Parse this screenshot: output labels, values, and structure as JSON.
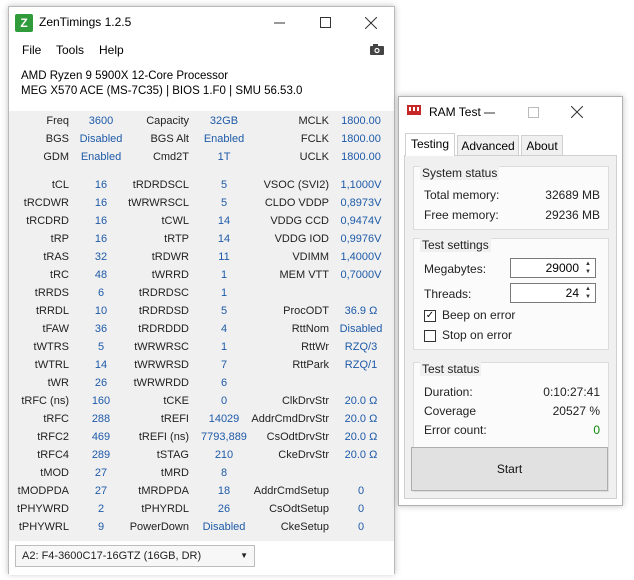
{
  "zentimings": {
    "title": "ZenTimings 1.2.5",
    "icon_letter": "Z",
    "menu": [
      "File",
      "Tools",
      "Help"
    ],
    "cpu_name": "AMD Ryzen 9 5900X 12-Core Processor",
    "board_info": "MEG X570 ACE (MS-7C35) | BIOS 1.F0 | SMU 56.53.0",
    "top_rows": [
      {
        "l1": "Freq",
        "v1": "3600",
        "l2": "Capacity",
        "v2": "32GB",
        "l3": "MCLK",
        "v3": "1800.00"
      },
      {
        "l1": "BGS",
        "v1": "Disabled",
        "l2": "BGS Alt",
        "v2": "Enabled",
        "l3": "FCLK",
        "v3": "1800.00"
      },
      {
        "l1": "GDM",
        "v1": "Enabled",
        "l2": "Cmd2T",
        "v2": "1T",
        "l3": "UCLK",
        "v3": "1800.00"
      }
    ],
    "rows": [
      {
        "l1": "tCL",
        "v1": "16",
        "l2": "tRDRDSCL",
        "v2": "5",
        "l3": "VSOC (SVI2)",
        "v3": "1,1000V"
      },
      {
        "l1": "tRCDWR",
        "v1": "16",
        "l2": "tWRWRSCL",
        "v2": "5",
        "l3": "CLDO VDDP",
        "v3": "0,8973V"
      },
      {
        "l1": "tRCDRD",
        "v1": "16",
        "l2": "tCWL",
        "v2": "14",
        "l3": "VDDG CCD",
        "v3": "0,9474V"
      },
      {
        "l1": "tRP",
        "v1": "16",
        "l2": "tRTP",
        "v2": "14",
        "l3": "VDDG IOD",
        "v3": "0,9976V"
      },
      {
        "l1": "tRAS",
        "v1": "32",
        "l2": "tRDWR",
        "v2": "11",
        "l3": "VDIMM",
        "v3": "1,4000V"
      },
      {
        "l1": "tRC",
        "v1": "48",
        "l2": "tWRRD",
        "v2": "1",
        "l3": "MEM VTT",
        "v3": "0,7000V"
      },
      {
        "l1": "tRRDS",
        "v1": "6",
        "l2": "tRDRDSC",
        "v2": "1",
        "l3": "",
        "v3": ""
      },
      {
        "l1": "tRRDL",
        "v1": "10",
        "l2": "tRDRDSD",
        "v2": "5",
        "l3": "ProcODT",
        "v3": "36.9 Ω"
      },
      {
        "l1": "tFAW",
        "v1": "36",
        "l2": "tRDRDDD",
        "v2": "4",
        "l3": "RttNom",
        "v3": "Disabled"
      },
      {
        "l1": "tWTRS",
        "v1": "5",
        "l2": "tWRWRSC",
        "v2": "1",
        "l3": "RttWr",
        "v3": "RZQ/3"
      },
      {
        "l1": "tWTRL",
        "v1": "14",
        "l2": "tWRWRSD",
        "v2": "7",
        "l3": "RttPark",
        "v3": "RZQ/1"
      },
      {
        "l1": "tWR",
        "v1": "26",
        "l2": "tWRWRDD",
        "v2": "6",
        "l3": "",
        "v3": ""
      },
      {
        "l1": "tRFC (ns)",
        "v1": "160",
        "l2": "tCKE",
        "v2": "0",
        "l3": "ClkDrvStr",
        "v3": "20.0 Ω"
      },
      {
        "l1": "tRFC",
        "v1": "288",
        "l2": "tREFI",
        "v2": "14029",
        "l3": "AddrCmdDrvStr",
        "v3": "20.0 Ω"
      },
      {
        "l1": "tRFC2",
        "v1": "469",
        "l2": "tREFI (ns)",
        "v2": "7793,889",
        "l3": "CsOdtDrvStr",
        "v3": "20.0 Ω"
      },
      {
        "l1": "tRFC4",
        "v1": "289",
        "l2": "tSTAG",
        "v2": "210",
        "l3": "CkeDrvStr",
        "v3": "20.0 Ω"
      },
      {
        "l1": "tMOD",
        "v1": "27",
        "l2": "tMRD",
        "v2": "8",
        "l3": "",
        "v3": ""
      },
      {
        "l1": "tMODPDA",
        "v1": "27",
        "l2": "tMRDPDA",
        "v2": "18",
        "l3": "AddrCmdSetup",
        "v3": "0"
      },
      {
        "l1": "tPHYWRD",
        "v1": "2",
        "l2": "tPHYRDL",
        "v2": "26",
        "l3": "CsOdtSetup",
        "v3": "0"
      },
      {
        "l1": "tPHYWRL",
        "v1": "9",
        "l2": "PowerDown",
        "v2": "Disabled",
        "l3": "CkeSetup",
        "v3": "0"
      }
    ],
    "dimm_selected": "A2: F4-3600C17-16GTZ (16GB, DR)"
  },
  "ramtest": {
    "title": "RAM Test",
    "tabs": [
      "Testing",
      "Advanced",
      "About"
    ],
    "system_status": {
      "title": "System status",
      "total_label": "Total memory:",
      "total_value": "32689 MB",
      "free_label": "Free memory:",
      "free_value": "29236 MB"
    },
    "test_settings": {
      "title": "Test settings",
      "megabytes_label": "Megabytes:",
      "megabytes_value": "29000",
      "threads_label": "Threads:",
      "threads_value": "24",
      "beep_label": "Beep on error",
      "beep_checked": true,
      "stop_label": "Stop on error",
      "stop_checked": false
    },
    "test_status": {
      "title": "Test status",
      "duration_label": "Duration:",
      "duration_value": "0:10:27:41",
      "coverage_label": "Coverage",
      "coverage_value": "20527 %",
      "errors_label": "Error count:",
      "errors_value": "0"
    },
    "start_label": "Start",
    "colors": {
      "error_ok": "#0a8a0a",
      "value_blue": "#1e5aa8",
      "zen_green": "#2f9b3a"
    }
  }
}
